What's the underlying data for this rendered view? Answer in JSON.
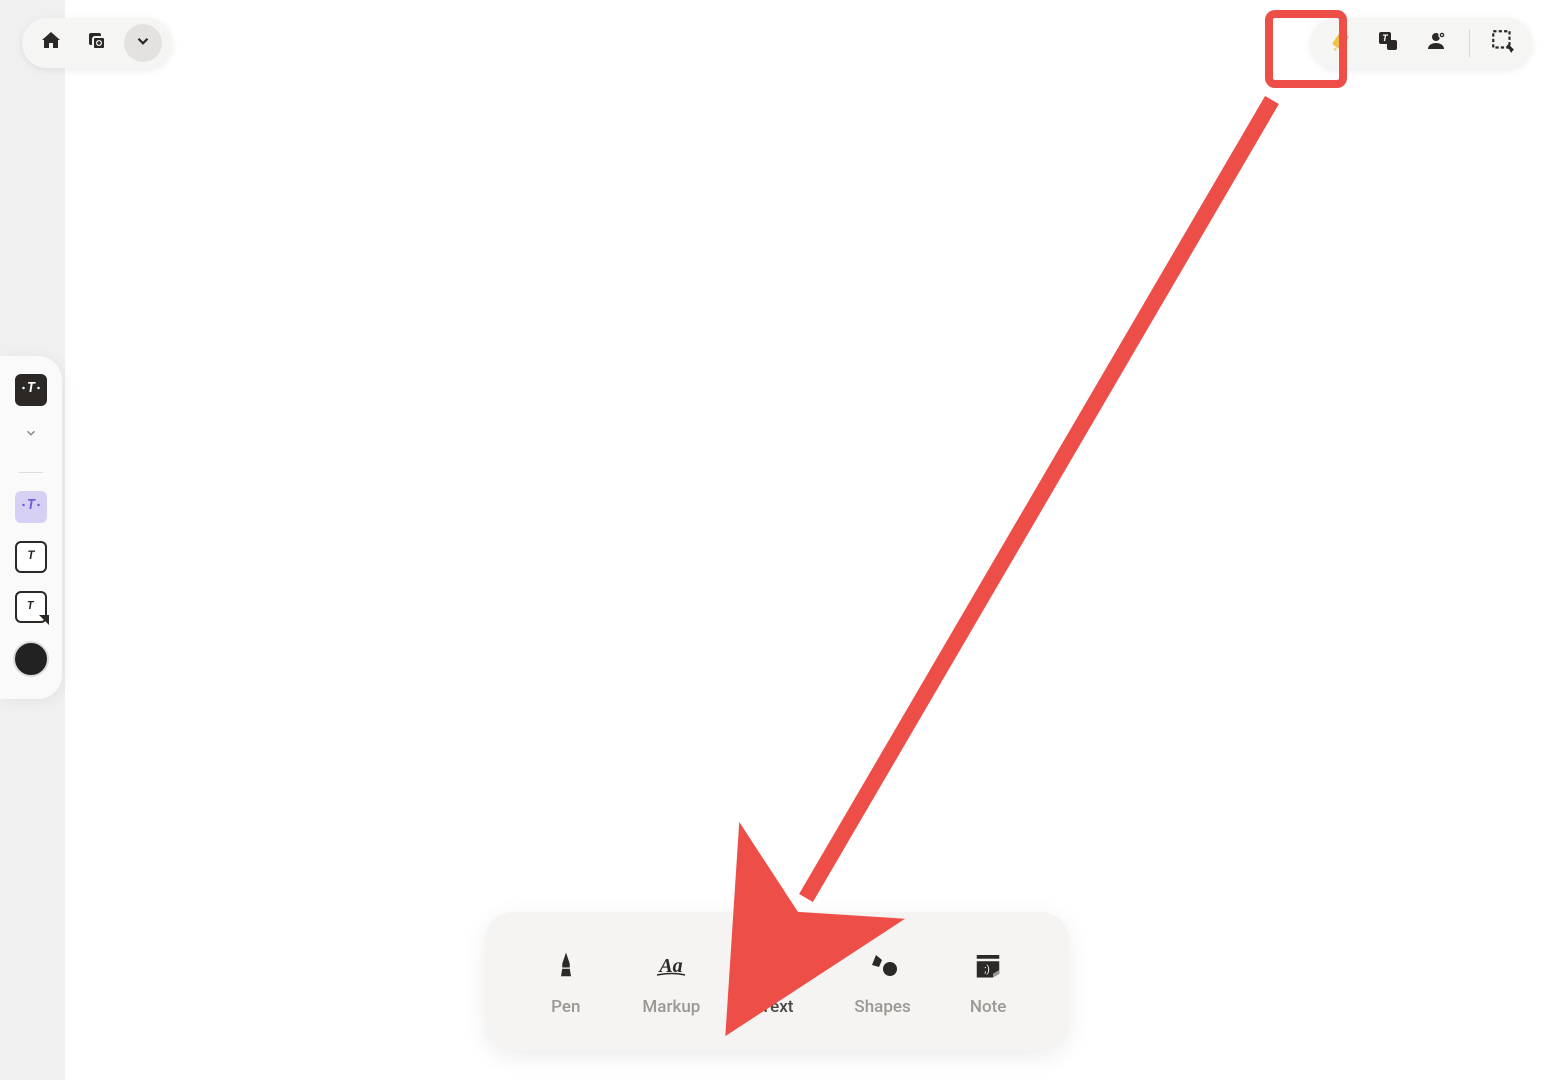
{
  "top_left": {
    "home": "home",
    "layers": "layers",
    "expand": "expand"
  },
  "top_right": {
    "annotate": "annotate",
    "text_tool": "text",
    "stamp": "image",
    "select": "lasso"
  },
  "side_panel": {
    "style1": "text-header",
    "style2": "text-boxed",
    "style3": "text-bordered",
    "style4": "text-sticky",
    "color": "#222222"
  },
  "bottom_bar": {
    "items": [
      {
        "label": "Pen",
        "active": false
      },
      {
        "label": "Markup",
        "active": false
      },
      {
        "label": "Text",
        "active": true
      },
      {
        "label": "Shapes",
        "active": false
      },
      {
        "label": "Note",
        "active": false
      }
    ]
  },
  "annotation": {
    "highlight_color": "#ee4e48"
  }
}
